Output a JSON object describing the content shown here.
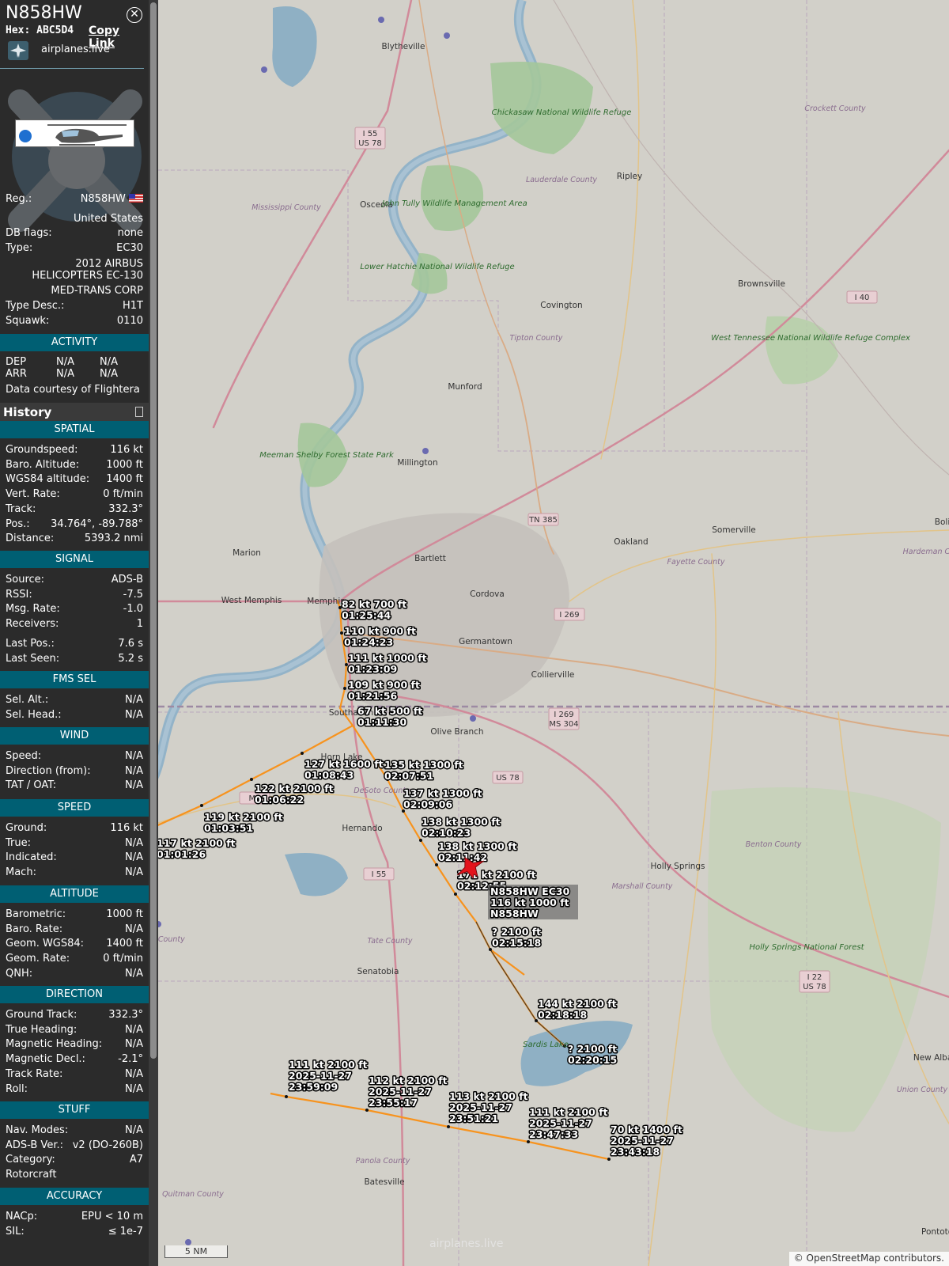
{
  "aircraft": {
    "callsign": "N858HW",
    "hex_label": "Hex:",
    "hex": "ABC5D4",
    "copy_link": "Copy Link",
    "site": "airplanes.live"
  },
  "info": {
    "reg_label": "Reg.:",
    "reg": "N858HW",
    "country": "United States",
    "dbflags_label": "DB flags:",
    "dbflags": "none",
    "type_label": "Type:",
    "type": "EC30",
    "desc_line1": "2012 AIRBUS",
    "desc_line2": "HELICOPTERS EC-130",
    "operator": "MED-TRANS CORP",
    "typedesc_label": "Type Desc.:",
    "typedesc": "H1T",
    "squawk_label": "Squawk:",
    "squawk": "0110"
  },
  "activity": {
    "header": "ACTIVITY",
    "dep": "DEP",
    "arr": "ARR",
    "na": "N/A",
    "courtesy": "Data courtesy of",
    "provider": "Flightera"
  },
  "history": {
    "label": "History"
  },
  "spatial": {
    "header": "SPATIAL",
    "rows": [
      {
        "k": "Groundspeed:",
        "v": "116 kt"
      },
      {
        "k": "Baro. Altitude:",
        "v": "1000 ft"
      },
      {
        "k": "WGS84 altitude:",
        "v": "1400 ft"
      },
      {
        "k": "Vert. Rate:",
        "v": "0 ft/min"
      },
      {
        "k": "Track:",
        "v": "332.3°"
      },
      {
        "k": "Pos.:",
        "v": "34.764°, -89.788°"
      },
      {
        "k": "Distance:",
        "v": "5393.2 nmi"
      }
    ]
  },
  "signal": {
    "header": "SIGNAL",
    "rows": [
      {
        "k": "Source:",
        "v": "ADS-B"
      },
      {
        "k": "RSSI:",
        "v": "-7.5"
      },
      {
        "k": "Msg. Rate:",
        "v": "-1.0"
      },
      {
        "k": "Receivers:",
        "v": "1"
      },
      {
        "k": "Last Pos.:",
        "v": "7.6 s"
      },
      {
        "k": "Last Seen:",
        "v": "5.2 s"
      }
    ]
  },
  "fms": {
    "header": "FMS SEL",
    "rows": [
      {
        "k": "Sel. Alt.:",
        "v": "N/A"
      },
      {
        "k": "Sel. Head.:",
        "v": "N/A"
      }
    ]
  },
  "wind": {
    "header": "WIND",
    "rows": [
      {
        "k": "Speed:",
        "v": "N/A"
      },
      {
        "k": "Direction (from):",
        "v": "N/A"
      },
      {
        "k": "TAT / OAT:",
        "v": "N/A"
      }
    ]
  },
  "speed": {
    "header": "SPEED",
    "rows": [
      {
        "k": "Ground:",
        "v": "116 kt"
      },
      {
        "k": "True:",
        "v": "N/A"
      },
      {
        "k": "Indicated:",
        "v": "N/A"
      },
      {
        "k": "Mach:",
        "v": "N/A"
      }
    ]
  },
  "altitude": {
    "header": "ALTITUDE",
    "rows": [
      {
        "k": "Barometric:",
        "v": "1000 ft"
      },
      {
        "k": "Baro. Rate:",
        "v": "N/A"
      },
      {
        "k": "Geom. WGS84:",
        "v": "1400 ft"
      },
      {
        "k": "Geom. Rate:",
        "v": "0 ft/min"
      },
      {
        "k": "QNH:",
        "v": "N/A"
      }
    ]
  },
  "direction": {
    "header": "DIRECTION",
    "rows": [
      {
        "k": "Ground Track:",
        "v": "332.3°"
      },
      {
        "k": "True Heading:",
        "v": "N/A"
      },
      {
        "k": "Magnetic Heading:",
        "v": "N/A"
      },
      {
        "k": "Magnetic Decl.:",
        "v": "-2.1°"
      },
      {
        "k": "Track Rate:",
        "v": "N/A"
      },
      {
        "k": "Roll:",
        "v": "N/A"
      }
    ]
  },
  "stuff": {
    "header": "STUFF",
    "rows": [
      {
        "k": "Nav. Modes:",
        "v": "N/A"
      },
      {
        "k": "ADS-B Ver.:",
        "v": "v2 (DO-260B)"
      },
      {
        "k": "Category:",
        "v": "A7"
      }
    ],
    "category_desc": "Rotorcraft"
  },
  "accuracy": {
    "header": "ACCURACY",
    "rows": [
      {
        "k": "NACp:",
        "v": "EPU < 10 m"
      },
      {
        "k": "SIL:",
        "v": "≤ 1e-7"
      }
    ]
  },
  "map": {
    "places": [
      "Blytheville",
      "Osceola",
      "Ripley",
      "Covington",
      "Brownsville",
      "Munford",
      "Millington",
      "Marion",
      "West Memphis",
      "Memphis",
      "Bartlett",
      "Cordova",
      "Germantown",
      "Collierville",
      "Oakland",
      "Somerville",
      "Southaven",
      "Horn Lake",
      "Olive Branch",
      "Hernando",
      "Holly Springs",
      "Senatobia",
      "Batesville",
      "New Albany",
      "Bolivar",
      "Pontotoc"
    ],
    "parks": [
      "Chickasaw National Wildlife Refuge",
      "John Tully Wildlife Management Area",
      "Lower Hatchie National Wildlife Refuge",
      "Meeman Shelby Forest State Park",
      "West Tennessee National Wildlife Refuge Complex",
      "Holly Springs National Forest",
      "Sardis Lake"
    ],
    "counties": [
      "Crockett County",
      "Lauderdale County",
      "Mississippi County",
      "Tipton County",
      "Fayette County",
      "Hardeman County",
      "DeSoto County",
      "Marshall County",
      "Benton County",
      "Tate County",
      "Panola County",
      "Union County",
      "Quitman County",
      "Tunica County"
    ],
    "shields": [
      "I 55",
      "US 78",
      "I 40",
      "TN 385",
      "I 269",
      "I 269",
      "MS 304",
      "I 55",
      "US 78",
      "I 22",
      "US 78",
      "MS"
    ],
    "track_labels": [
      [
        "82 kt  700 ft",
        "01:25:44"
      ],
      [
        "110 kt  900 ft",
        "01:24:23"
      ],
      [
        "111 kt  1000 ft",
        "01:23:09"
      ],
      [
        "109 kt  900 ft",
        "01:21:56"
      ],
      [
        "67 kt  500 ft",
        "01:11:30"
      ],
      [
        "127 kt  1600 ft",
        "01:08:43"
      ],
      [
        "122 kt  2100 ft",
        "01:06:22"
      ],
      [
        "119 kt  2100 ft",
        "01:03:51"
      ],
      [
        "117 kt  2100 ft",
        "01:01:26"
      ],
      [
        "135 kt  1300 ft",
        "02:07:51"
      ],
      [
        "137 kt  1300 ft",
        "02:09:06"
      ],
      [
        "138 kt  1300 ft",
        "02:10:23"
      ],
      [
        "138 kt  1300 ft",
        "02:11:42"
      ],
      [
        "171 kt  2100 ft",
        "02:12:55"
      ],
      [
        "?  2100 ft",
        "02:15:18"
      ],
      [
        "144 kt  2100 ft",
        "02:18:18"
      ],
      [
        "?  2100 ft",
        "02:20:15"
      ],
      [
        "111 kt  2100 ft",
        "2025-11-27",
        "23:59:09"
      ],
      [
        "112 kt  2100 ft",
        "2025-11-27",
        "23:55:17"
      ],
      [
        "113 kt  2100 ft",
        "2025-11-27",
        "23:51:21"
      ],
      [
        "111 kt  2100 ft",
        "2025-11-27",
        "23:47:33"
      ],
      [
        "70 kt  1400 ft",
        "2025-11-27",
        "23:43:18"
      ]
    ],
    "plane_label": [
      "N858HW EC30",
      "116 kt  1000 ft",
      "N858HW"
    ],
    "scale": "5 NM",
    "watermark": "airplanes.live",
    "attribution_prefix": "© ",
    "attribution_link": "OpenStreetMap",
    "attribution_suffix": " contributors."
  },
  "colors": {
    "accent": "#005f73",
    "track": "#f7931e",
    "plane": "#e3141c",
    "panel": "#2b2b2b"
  }
}
